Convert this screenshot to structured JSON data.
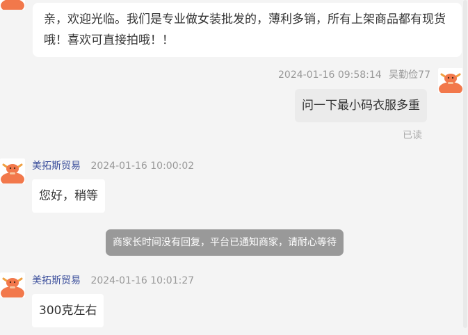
{
  "messages": [
    {
      "text": "亲，欢迎光临。我们是专业做女装批发的，薄利多销，所有上架商品都有现货哦！喜欢可直接拍哦！！"
    },
    {
      "time": "2024-01-16 09:58:14",
      "name": "吴勤俭77",
      "text": "问一下最小码衣服多重",
      "status": "已读"
    },
    {
      "name": "美拓斯贸易",
      "time": "2024-01-16 10:00:02",
      "text": "您好，稍等"
    },
    {
      "notice": "商家长时间没有回复，平台已通知商家，请耐心等待"
    },
    {
      "name": "美拓斯贸易",
      "time": "2024-01-16 10:01:27",
      "text": "300克左右"
    }
  ],
  "colors": {
    "background": "#f4f4f4",
    "seller_name": "#3c4f9c",
    "avatar": "#f2784b",
    "notice_bg": "#999999"
  },
  "icons": {
    "avatar": "bull-mascot-icon"
  }
}
